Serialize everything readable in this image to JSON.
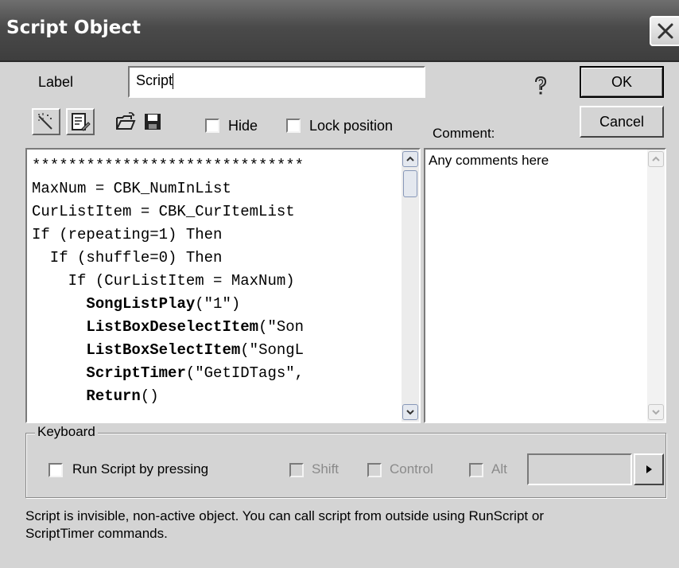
{
  "window": {
    "title": "Script Object"
  },
  "form": {
    "label_caption": "Label",
    "label_value": "Script",
    "ok_label": "OK",
    "cancel_label": "Cancel",
    "hide_label": "Hide",
    "lock_label": "Lock position",
    "comment_caption": "Comment:",
    "hide_checked": false,
    "lock_checked": false
  },
  "toolbar": {
    "icons": [
      "wizard-wand-icon",
      "edit-document-icon",
      "open-folder-icon",
      "save-disk-icon"
    ]
  },
  "code": {
    "lines": [
      [
        {
          "t": "******************************",
          "b": false
        }
      ],
      [
        {
          "t": "MaxNum = CBK_NumInList",
          "b": false
        }
      ],
      [
        {
          "t": "CurListItem = CBK_CurItemList",
          "b": false
        }
      ],
      [
        {
          "t": "If (repeating=1) Then",
          "b": false
        }
      ],
      [
        {
          "t": "  If (shuffle=0) Then",
          "b": false
        }
      ],
      [
        {
          "t": "    If (CurListItem = MaxNum)",
          "b": false
        }
      ],
      [
        {
          "t": "      ",
          "b": false
        },
        {
          "t": "SongListPlay",
          "b": true
        },
        {
          "t": "(\"1\")",
          "b": false
        }
      ],
      [
        {
          "t": "      ",
          "b": false
        },
        {
          "t": "ListBoxDeselectItem",
          "b": true
        },
        {
          "t": "(\"Son",
          "b": false
        }
      ],
      [
        {
          "t": "      ",
          "b": false
        },
        {
          "t": "ListBoxSelectItem",
          "b": true
        },
        {
          "t": "(\"SongL",
          "b": false
        }
      ],
      [
        {
          "t": "      ",
          "b": false
        },
        {
          "t": "ScriptTimer",
          "b": true
        },
        {
          "t": "(\"GetIDTags\",",
          "b": false
        }
      ],
      [
        {
          "t": "      ",
          "b": false
        },
        {
          "t": "Return",
          "b": true
        },
        {
          "t": "()",
          "b": false
        }
      ]
    ]
  },
  "comment": {
    "text": "Any comments here"
  },
  "keyboard": {
    "group_label": "Keyboard",
    "run_label": "Run Script by pressing",
    "shift_label": "Shift",
    "control_label": "Control",
    "alt_label": "Alt",
    "key_value": ""
  },
  "footer": {
    "line1": "Script is invisible, non-active object. You can call script from outside using RunScript or",
    "line2": "ScriptTimer commands."
  },
  "colors": {
    "title_bar": "#4a4a4a",
    "dialog_bg": "#d4d4d4",
    "disabled_text": "#8a8a8a"
  }
}
